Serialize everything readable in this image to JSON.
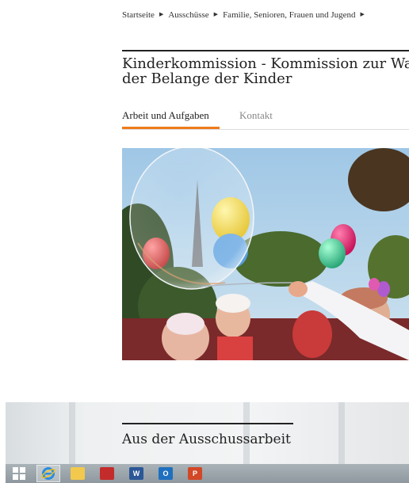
{
  "breadcrumb": {
    "items": [
      "Startseite",
      "Ausschüsse",
      "Familie, Senioren, Frauen und Jugend"
    ]
  },
  "page": {
    "title_line1": "Kinderkommission - Kommission zur Wa",
    "title_line2": "der Belange der Kinder"
  },
  "tabs": [
    {
      "label": "Arbeit und Aufgaben",
      "active": true
    },
    {
      "label": "Kontakt",
      "active": false
    }
  ],
  "sections": {
    "committee_work_title": "Aus der Ausschussarbeit"
  },
  "taskbar": {
    "items": [
      "windows-start-icon",
      "internet-explorer-icon",
      "file-explorer-icon",
      "app-red-icon",
      "word-icon",
      "outlook-icon",
      "powerpoint-icon"
    ]
  },
  "colors": {
    "accent": "#ef7b1c",
    "text": "#222222"
  }
}
